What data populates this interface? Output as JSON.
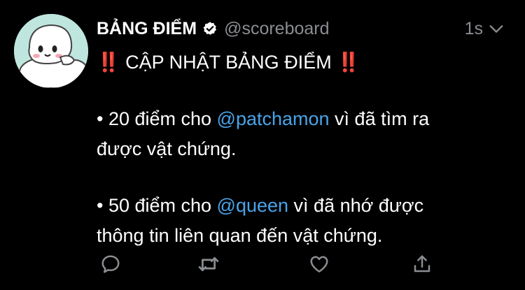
{
  "tweet": {
    "display_name": "BẢNG ĐIỂM",
    "handle": "@scoreboard",
    "time": "1s",
    "headline": {
      "prefix": "‼️",
      "text": " CẬP NHẬT BẢNG ĐIỂM ",
      "suffix": "‼️"
    },
    "item1": {
      "prefix": "• 20 điểm cho ",
      "mention": "@patchamon",
      "rest": " vì đã tìm ra",
      "line2": "được vật chứng."
    },
    "item2": {
      "prefix": "• 50 điểm cho ",
      "mention": "@queen",
      "rest": " vì đã nhớ được",
      "line2": "thông tin liên quan đến vật chứng."
    }
  },
  "icons": {
    "verified": "verified-badge-icon",
    "caret": "chevron-down-icon",
    "reply": "reply-icon",
    "retweet": "retweet-icon",
    "like": "heart-icon",
    "share": "share-icon"
  },
  "colors": {
    "background": "#000000",
    "text": "#ffffff",
    "secondary": "#8a8d91",
    "mention": "#4aa3e8",
    "alert": "#e0231b",
    "avatar_bg": "#bfe6de"
  }
}
